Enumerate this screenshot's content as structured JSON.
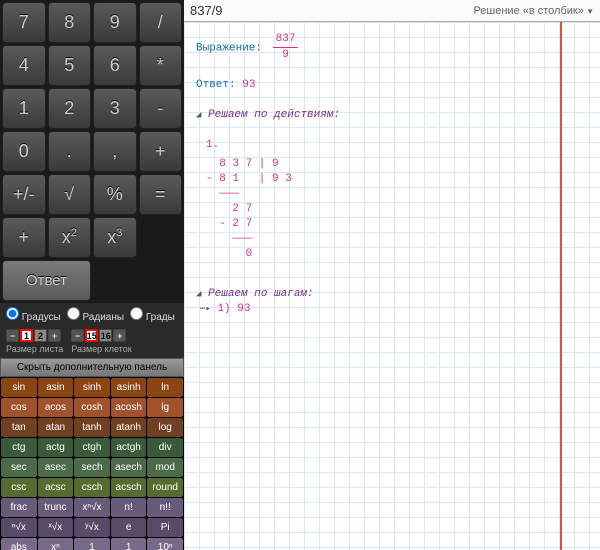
{
  "keys": {
    "k7": "7",
    "k8": "8",
    "k9": "9",
    "kdiv": "/",
    "k4": "4",
    "k5": "5",
    "k6": "6",
    "kmul": "*",
    "k1": "1",
    "k2": "2",
    "k3": "3",
    "kmin": "-",
    "k0": "0",
    "kdot": ".",
    "kcom": ",",
    "kplus": "+",
    "kpm": "+/-",
    "ksqrt": "√",
    "kpct": "%",
    "keq": "=",
    "kbsp": "+",
    "kx2": "x²",
    "kx3": "x³",
    "kans": "Ответ"
  },
  "angle": {
    "deg": "Градусы",
    "rad": "Радианы",
    "grad": "Грады"
  },
  "sizes": {
    "sheet_lbl": "Размер листа",
    "cell_lbl": "Размер клеток",
    "sheet_val": "1",
    "sheet2": "2",
    "cell_val": "15",
    "cell2": "16",
    "minus": "−",
    "plus": "+"
  },
  "hidebar": "Скрыть дополнительную панель",
  "func": [
    [
      "sin",
      "asin",
      "sinh",
      "asinh",
      "ln"
    ],
    [
      "cos",
      "acos",
      "cosh",
      "acosh",
      "lg"
    ],
    [
      "tan",
      "atan",
      "tanh",
      "atanh",
      "log"
    ],
    [
      "ctg",
      "actg",
      "ctgh",
      "actgh",
      "div"
    ],
    [
      "sec",
      "asec",
      "sech",
      "asech",
      "mod"
    ],
    [
      "csc",
      "acsc",
      "csch",
      "acsch",
      "round"
    ],
    [
      "frac",
      "trunc",
      "xⁿ√x",
      "n!",
      "n!!"
    ],
    [
      "ⁿ√x",
      "ˣ√x",
      "ʸ√x",
      "e",
      "Pi"
    ],
    [
      "abs",
      "xⁿ",
      "1",
      "1",
      "10ⁿ"
    ]
  ],
  "top": {
    "expr": "837/9",
    "mode": "Решение «в столбик»"
  },
  "sol": {
    "expr_lbl": "Выражение:",
    "expr_num": "837",
    "expr_den": "9",
    "ans_lbl": "Ответ:",
    "ans": "93",
    "act_lbl": "Решаем по действиям:",
    "step1": "1.",
    "longdiv": "  8 3 7 | 9\n- 8 1   | 9 3\n  ———\n    2 7\n  - 2 7\n    ———\n      0",
    "steps_lbl": "Решаем по шагам:",
    "steps_row": "1) 93"
  }
}
